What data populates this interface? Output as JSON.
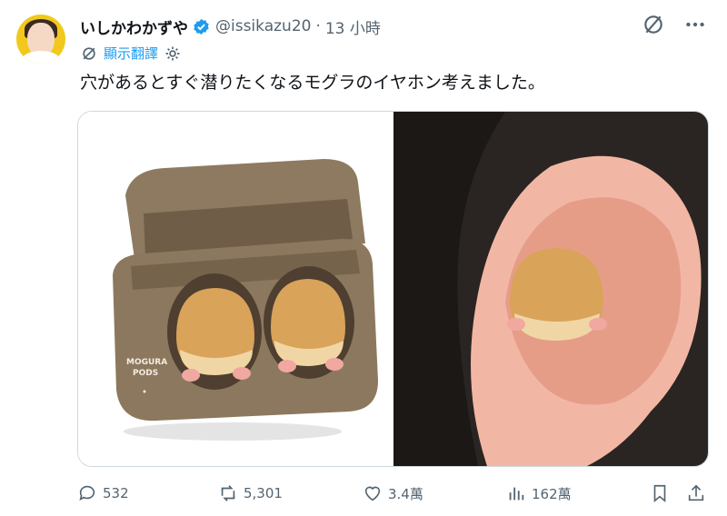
{
  "tweet": {
    "author_name": "いしかわかずや",
    "handle": "@issikazu20",
    "separator": "·",
    "time": "13 小時",
    "translate_label": "顯示翻譯",
    "text": "穴があるとすぐ潜りたくなるモグラのイヤホン考えました。",
    "image_case_text_line1": "MOGURA",
    "image_case_text_line2": "PODS"
  },
  "actions": {
    "replies": "532",
    "reposts": "5,301",
    "likes": "3.4萬",
    "views": "162萬"
  },
  "colors": {
    "accent": "#1d9bf0",
    "secondary_text": "#536471",
    "verified": "#1d9bf0"
  },
  "icons": [
    "grok-icon",
    "more-icon",
    "translate-settings-icon",
    "reply-icon",
    "repost-icon",
    "like-icon",
    "views-icon",
    "bookmark-icon",
    "share-icon"
  ]
}
